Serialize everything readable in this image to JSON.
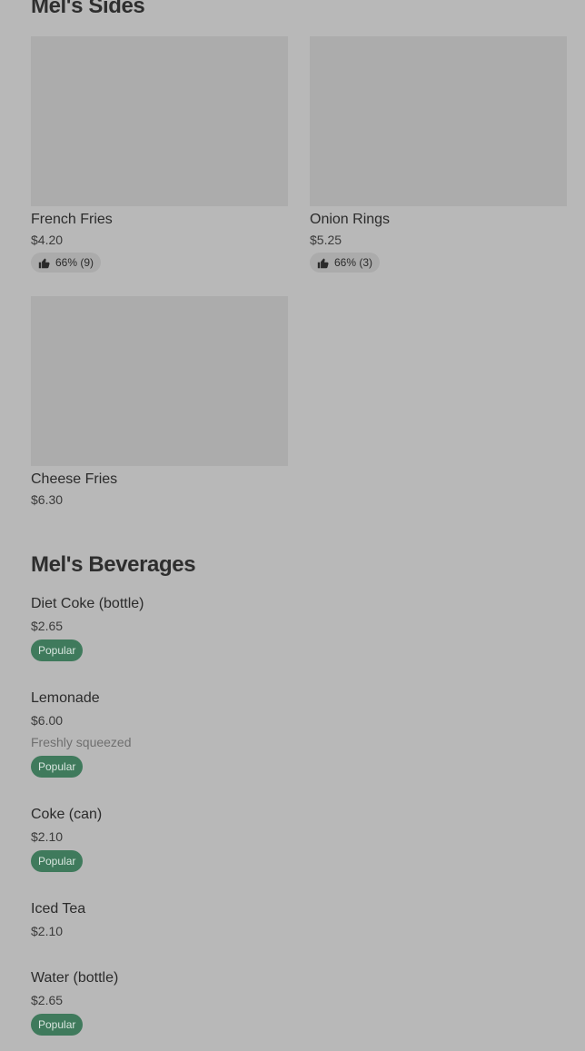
{
  "sections": {
    "sides": {
      "title": "Mel's Sides",
      "items": [
        {
          "name": "French Fries",
          "price": "$4.20",
          "rating": "66% (9)"
        },
        {
          "name": "Onion Rings",
          "price": "$5.25",
          "rating": "66% (3)"
        },
        {
          "name": "Cheese Fries",
          "price": "$6.30"
        }
      ]
    },
    "beverages": {
      "title": "Mel's Beverages",
      "items": [
        {
          "name": "Diet Coke (bottle)",
          "price": "$2.65",
          "badge": "Popular"
        },
        {
          "name": "Lemonade",
          "price": "$6.00",
          "description": "Freshly squeezed",
          "badge": "Popular"
        },
        {
          "name": "Coke (can)",
          "price": "$2.10",
          "badge": "Popular"
        },
        {
          "name": "Iced Tea",
          "price": "$2.10"
        },
        {
          "name": "Water (bottle)",
          "price": "$2.65",
          "badge": "Popular"
        }
      ]
    }
  },
  "icons": {
    "rating": "thumbs-up-icon"
  },
  "colors": {
    "background": "#b8b8b8",
    "image_placeholder": "#acacac",
    "popular_badge": "#3f7a5c"
  }
}
